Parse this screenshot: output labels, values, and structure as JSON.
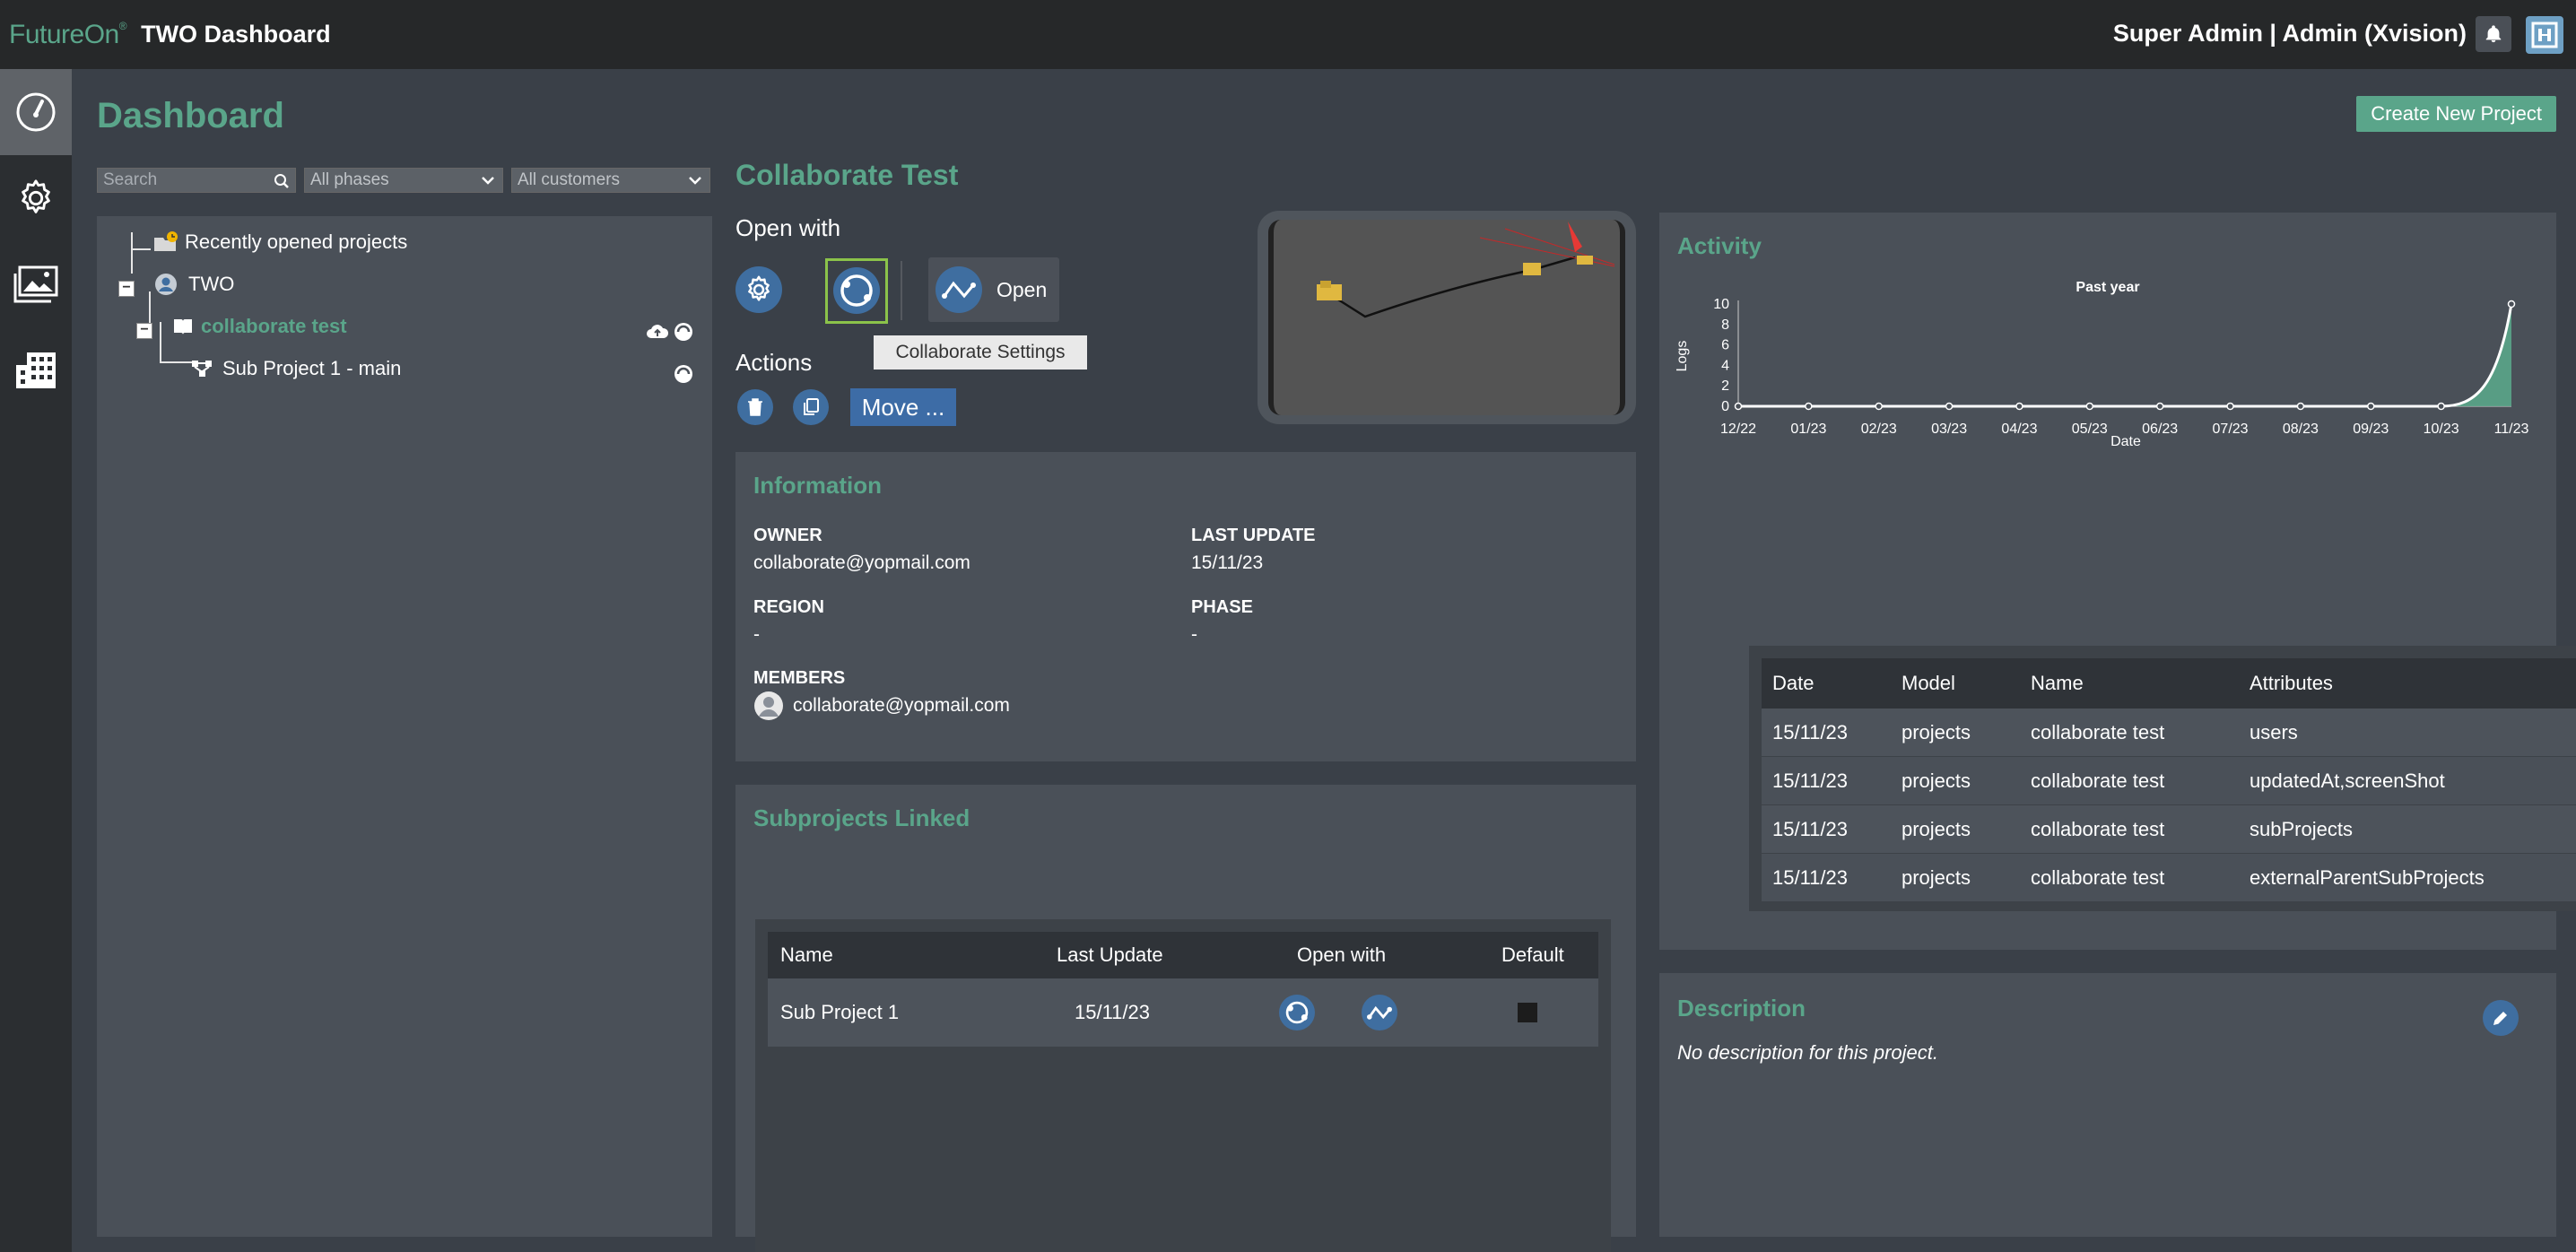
{
  "topbar": {
    "brand": "FutureOn",
    "brand_mark": "®",
    "title": "TWO Dashboard",
    "user": "Super Admin | Admin (Xvision)"
  },
  "sidebar": {
    "items": [
      {
        "icon": "dashboard-icon",
        "active": true
      },
      {
        "icon": "gear-icon",
        "active": false
      },
      {
        "icon": "image-icon",
        "active": false
      },
      {
        "icon": "building-icon",
        "active": false
      }
    ]
  },
  "header": {
    "title": "Dashboard",
    "create_button": "Create New Project"
  },
  "filters": {
    "search_placeholder": "Search",
    "phase": "All phases",
    "customer": "All customers"
  },
  "tree": {
    "recent": "Recently opened projects",
    "company": "TWO",
    "project": "collaborate test",
    "subproject": "Sub Project 1 - main",
    "expand_symbol": "−"
  },
  "project": {
    "title": "Collaborate Test",
    "open_with_label": "Open with",
    "open_label": "Open",
    "tooltip": "Collaborate Settings",
    "actions_label": "Actions",
    "move_label": "Move ..."
  },
  "information": {
    "title": "Information",
    "owner_label": "OWNER",
    "owner": "collaborate@yopmail.com",
    "last_update_label": "LAST UPDATE",
    "last_update": "15/11/23",
    "region_label": "REGION",
    "region": "-",
    "phase_label": "PHASE",
    "phase": "-",
    "members_label": "MEMBERS",
    "member": "collaborate@yopmail.com"
  },
  "subprojects": {
    "title": "Subprojects Linked",
    "columns": [
      "Name",
      "Last Update",
      "Open with",
      "Default"
    ],
    "rows": [
      {
        "name": "Sub Project 1",
        "last_update": "15/11/23"
      }
    ]
  },
  "activity": {
    "title": "Activity",
    "columns": [
      "Date",
      "Model",
      "Name",
      "Attributes"
    ],
    "rows": [
      {
        "date": "15/11/23",
        "model": "projects",
        "name": "collaborate test",
        "attributes": "users"
      },
      {
        "date": "15/11/23",
        "model": "projects",
        "name": "collaborate test",
        "attributes": "updatedAt,screenShot"
      },
      {
        "date": "15/11/23",
        "model": "projects",
        "name": "collaborate test",
        "attributes": "subProjects"
      },
      {
        "date": "15/11/23",
        "model": "projects",
        "name": "collaborate test",
        "attributes": "externalParentSubProjects"
      }
    ]
  },
  "chart_data": {
    "type": "area",
    "title": "Past year",
    "xlabel": "Date",
    "ylabel": "Logs",
    "categories": [
      "12/22",
      "01/23",
      "02/23",
      "03/23",
      "04/23",
      "05/23",
      "06/23",
      "07/23",
      "08/23",
      "09/23",
      "10/23",
      "11/23"
    ],
    "values": [
      0,
      0,
      0,
      0,
      0,
      0,
      0,
      0,
      0,
      0,
      0,
      10
    ],
    "yticks": [
      0,
      2,
      4,
      6,
      8,
      10
    ],
    "ylim": [
      0,
      10
    ],
    "color": "#5aa58a",
    "grid": false
  },
  "description": {
    "title": "Description",
    "text": "No description for this project."
  }
}
